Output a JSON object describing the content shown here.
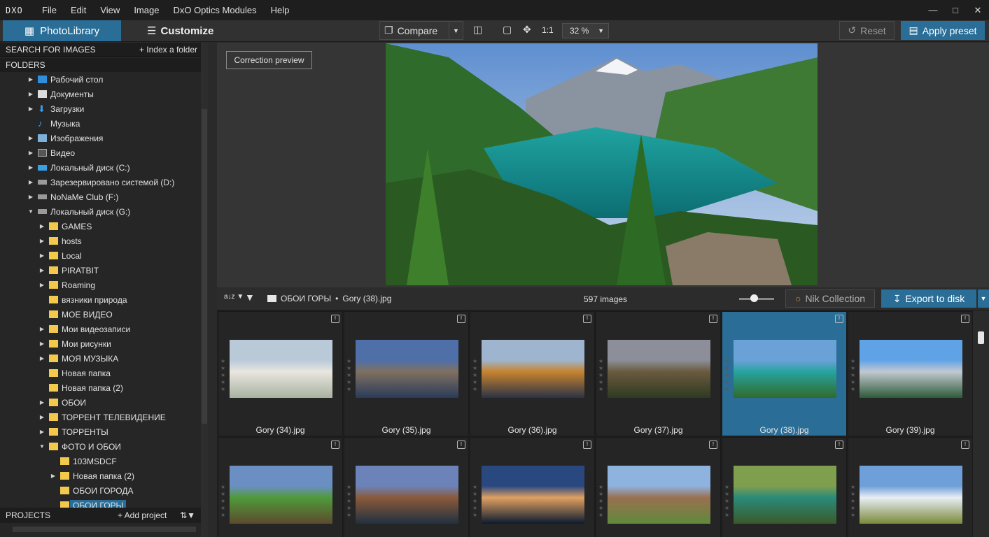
{
  "app": {
    "logo": "DXO",
    "menu": [
      "File",
      "Edit",
      "View",
      "Image",
      "DxO Optics Modules",
      "Help"
    ],
    "window_controls": [
      "minimize",
      "maximize",
      "close"
    ]
  },
  "toolbar": {
    "tab_photolibrary": "PhotoLibrary",
    "tab_customize": "Customize",
    "compare_label": "Compare",
    "zoom_ratio": "1:1",
    "zoom_value": "32 %",
    "reset_label": "Reset",
    "apply_label": "Apply preset"
  },
  "sidebar": {
    "search_label": "SEARCH FOR IMAGES",
    "index_label": "+ Index a folder",
    "folders_label": "FOLDERS",
    "projects_label": "PROJECTS",
    "add_project_label": "+ Add project",
    "tree": [
      {
        "label": "Рабочий стол",
        "icon": "desktop-icon",
        "depth": 0,
        "arrow": "right"
      },
      {
        "label": "Документы",
        "icon": "document-icon",
        "depth": 0,
        "arrow": "right"
      },
      {
        "label": "Загрузки",
        "icon": "download-icon",
        "depth": 0,
        "arrow": "right"
      },
      {
        "label": "Музыка",
        "icon": "music-icon",
        "depth": 0,
        "arrow": "none"
      },
      {
        "label": "Изображения",
        "icon": "image-icon",
        "depth": 0,
        "arrow": "right"
      },
      {
        "label": "Видео",
        "icon": "video-icon",
        "depth": 0,
        "arrow": "right"
      },
      {
        "label": "Локальный диск (C:)",
        "icon": "drive-c-icon",
        "depth": 0,
        "arrow": "right"
      },
      {
        "label": "Зарезервировано системой (D:)",
        "icon": "drive-icon",
        "depth": 0,
        "arrow": "right"
      },
      {
        "label": "NoNaMe Club (F:)",
        "icon": "drive-icon",
        "depth": 0,
        "arrow": "right"
      },
      {
        "label": "Локальный диск (G:)",
        "icon": "drive-icon",
        "depth": 0,
        "arrow": "down"
      },
      {
        "label": "GAMES",
        "icon": "folder-icon",
        "depth": 1,
        "arrow": "right"
      },
      {
        "label": "hosts",
        "icon": "folder-icon",
        "depth": 1,
        "arrow": "right"
      },
      {
        "label": "Local",
        "icon": "folder-icon",
        "depth": 1,
        "arrow": "right"
      },
      {
        "label": "PIRATBIT",
        "icon": "folder-icon",
        "depth": 1,
        "arrow": "right"
      },
      {
        "label": "Roaming",
        "icon": "folder-icon",
        "depth": 1,
        "arrow": "right"
      },
      {
        "label": "вязники природа",
        "icon": "folder-icon",
        "depth": 1,
        "arrow": "none"
      },
      {
        "label": "МОЕ ВИДЕО",
        "icon": "folder-icon",
        "depth": 1,
        "arrow": "none"
      },
      {
        "label": "Мои видеозаписи",
        "icon": "video-folder-icon",
        "depth": 1,
        "arrow": "right"
      },
      {
        "label": "Мои рисунки",
        "icon": "folder-icon",
        "depth": 1,
        "arrow": "right"
      },
      {
        "label": "МОЯ МУЗЫКА",
        "icon": "folder-icon",
        "depth": 1,
        "arrow": "right"
      },
      {
        "label": "Новая папка",
        "icon": "folder-icon",
        "depth": 1,
        "arrow": "none"
      },
      {
        "label": "Новая папка (2)",
        "icon": "folder-icon",
        "depth": 1,
        "arrow": "none"
      },
      {
        "label": "ОБОИ",
        "icon": "folder-icon",
        "depth": 1,
        "arrow": "right"
      },
      {
        "label": "ТОРРЕНТ ТЕЛЕВИДЕНИЕ",
        "icon": "folder-icon",
        "depth": 1,
        "arrow": "right"
      },
      {
        "label": "ТОРРЕНТЫ",
        "icon": "folder-icon",
        "depth": 1,
        "arrow": "right"
      },
      {
        "label": "ФОТО И ОБОИ",
        "icon": "folder-icon",
        "depth": 1,
        "arrow": "down"
      },
      {
        "label": "103MSDCF",
        "icon": "folder-icon",
        "depth": 2,
        "arrow": "none"
      },
      {
        "label": "Новая папка (2)",
        "icon": "folder-icon",
        "depth": 2,
        "arrow": "right"
      },
      {
        "label": "ОБОИ ГОРОДА",
        "icon": "folder-icon",
        "depth": 2,
        "arrow": "none"
      },
      {
        "label": "ОБОИ ГОРЫ",
        "icon": "folder-icon",
        "depth": 2,
        "arrow": "none",
        "selected": true
      }
    ]
  },
  "viewer": {
    "correction_preview_label": "Correction preview"
  },
  "filmstrip": {
    "folder": "ОБОИ ГОРЫ",
    "separator": "•",
    "file": "Gory (38).jpg",
    "count": "597 images",
    "nik_label": "Nik Collection",
    "export_label": "Export to disk",
    "thumbnails": [
      {
        "name": "Gory (34).jpg",
        "selected": false
      },
      {
        "name": "Gory (35).jpg",
        "selected": false
      },
      {
        "name": "Gory (36).jpg",
        "selected": false
      },
      {
        "name": "Gory (37).jpg",
        "selected": false
      },
      {
        "name": "Gory (38).jpg",
        "selected": true
      },
      {
        "name": "Gory (39).jpg",
        "selected": false
      },
      {
        "name": "",
        "selected": false
      },
      {
        "name": "",
        "selected": false
      },
      {
        "name": "",
        "selected": false
      },
      {
        "name": "",
        "selected": false
      },
      {
        "name": "",
        "selected": false
      },
      {
        "name": "",
        "selected": false
      }
    ]
  },
  "colors": {
    "accent": "#2a6d96",
    "folder": "#f2c94c",
    "background": "#2b2b2b"
  }
}
